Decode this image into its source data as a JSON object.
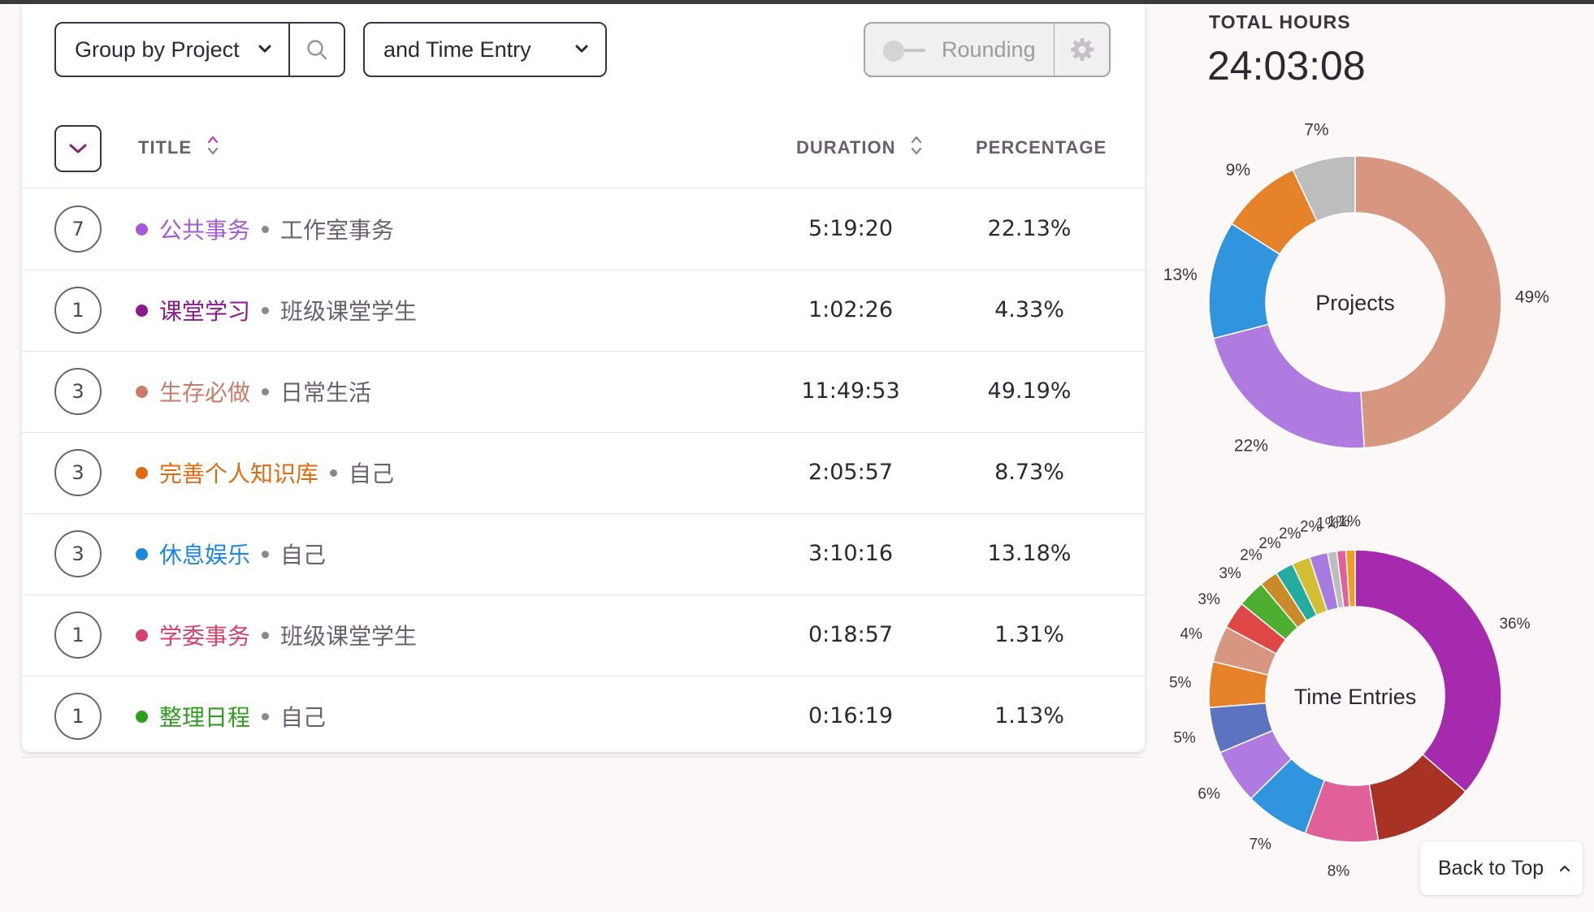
{
  "toolbar": {
    "group_label": "Group by Project",
    "entry_label": "and Time Entry",
    "rounding_label": "Rounding"
  },
  "table": {
    "headers": {
      "title": "TITLE",
      "duration": "DURATION",
      "percentage": "PERCENTAGE"
    },
    "rows": [
      {
        "count": "7",
        "project": "公共事务",
        "client": "工作室事务",
        "duration": "5:19:20",
        "percentage": "22.13%",
        "color": "#a35bd6"
      },
      {
        "count": "1",
        "project": "课堂学习",
        "client": "班级课堂学生",
        "duration": "1:02:26",
        "percentage": "4.33%",
        "color": "#8a1a8a"
      },
      {
        "count": "3",
        "project": "生存必做",
        "client": "日常生活",
        "duration": "11:49:53",
        "percentage": "49.19%",
        "color": "#c77d68"
      },
      {
        "count": "3",
        "project": "完善个人知识库",
        "client": "自己",
        "duration": "2:05:57",
        "percentage": "8.73%",
        "color": "#e06a10"
      },
      {
        "count": "3",
        "project": "休息娱乐",
        "client": "自己",
        "duration": "3:10:16",
        "percentage": "13.18%",
        "color": "#1c88d9"
      },
      {
        "count": "1",
        "project": "学委事务",
        "client": "班级课堂学生",
        "duration": "0:18:57",
        "percentage": "1.31%",
        "color": "#d6406f"
      },
      {
        "count": "1",
        "project": "整理日程",
        "client": "自己",
        "duration": "0:16:19",
        "percentage": "1.13%",
        "color": "#2f9e1f"
      }
    ]
  },
  "summary": {
    "total_label": "TOTAL HOURS",
    "total_value": "24:03:08"
  },
  "back_to_top": "Back to Top",
  "chart_data": [
    {
      "type": "pie",
      "title": "Projects",
      "slices": [
        {
          "label": "49%",
          "value": 49,
          "color": "#d6967f"
        },
        {
          "label": "22%",
          "value": 22,
          "color": "#b07be0"
        },
        {
          "label": "13%",
          "value": 13,
          "color": "#3094de"
        },
        {
          "label": "9%",
          "value": 9,
          "color": "#e6822a"
        },
        {
          "label": "7%",
          "value": 7,
          "color": "#bdbdbd"
        }
      ]
    },
    {
      "type": "pie",
      "title": "Time Entries",
      "slices": [
        {
          "label": "36%",
          "value": 36,
          "color": "#a52aad"
        },
        {
          "label": "",
          "value": 11,
          "color": "#a83223"
        },
        {
          "label": "8%",
          "value": 8,
          "color": "#e0609a"
        },
        {
          "label": "7%",
          "value": 7,
          "color": "#3094de"
        },
        {
          "label": "6%",
          "value": 6,
          "color": "#b07be0"
        },
        {
          "label": "5%",
          "value": 5,
          "color": "#5c73bf"
        },
        {
          "label": "5%",
          "value": 5,
          "color": "#e6822a"
        },
        {
          "label": "4%",
          "value": 4,
          "color": "#d6967f"
        },
        {
          "label": "3%",
          "value": 3,
          "color": "#e04848"
        },
        {
          "label": "3%",
          "value": 3,
          "color": "#4caf30"
        },
        {
          "label": "2%",
          "value": 2,
          "color": "#c98a2a"
        },
        {
          "label": "2%",
          "value": 2,
          "color": "#25aaa0"
        },
        {
          "label": "2%",
          "value": 2,
          "color": "#d4be33"
        },
        {
          "label": "2%",
          "value": 2,
          "color": "#a87be0"
        },
        {
          "label": "1%",
          "value": 1,
          "color": "#bdbdbd"
        },
        {
          "label": "1%",
          "value": 1,
          "color": "#e0609a"
        },
        {
          "label": "1%",
          "value": 1,
          "color": "#f0a020"
        }
      ]
    }
  ]
}
